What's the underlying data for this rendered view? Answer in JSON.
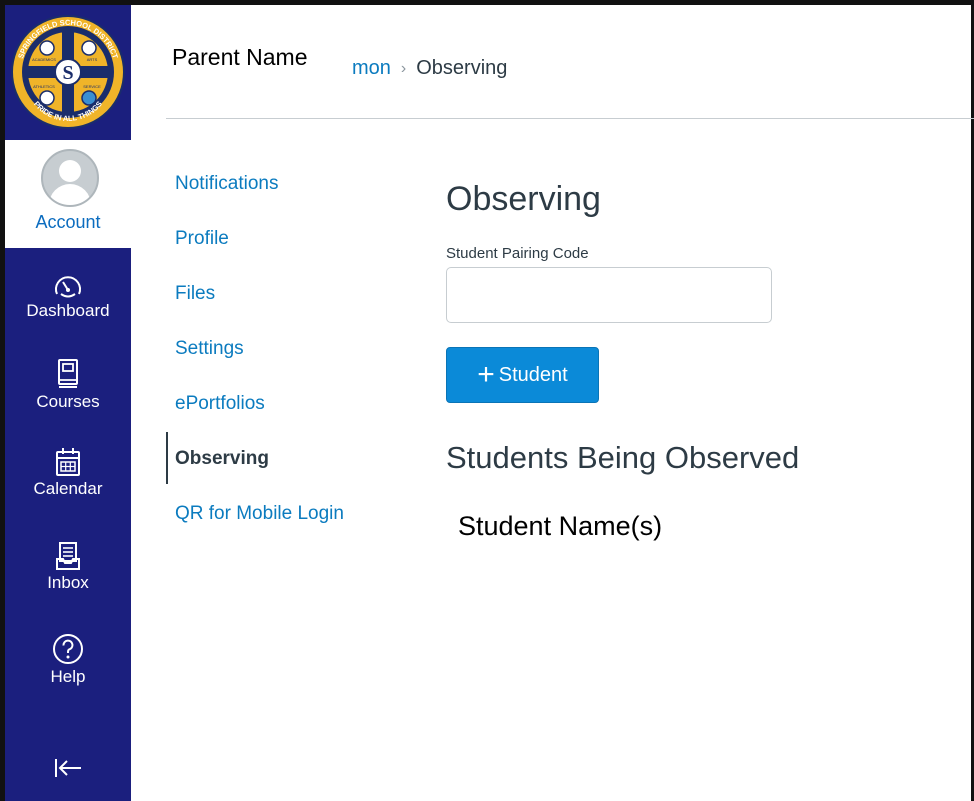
{
  "window": {
    "parent_name": "Parent Name"
  },
  "global_nav": {
    "logo": {
      "alt": "Springfield School District seal",
      "top_text": "SPRINGFIELD SCHOOL DISTRICT",
      "bottom_text": "PRIDE IN ALL THINGS",
      "quadrants": [
        "ACADEMICS",
        "ARTS",
        "ATHLETICS",
        "SERVICE"
      ],
      "center_letter": "S"
    },
    "account": {
      "label": "Account",
      "icon": "user-avatar-icon"
    },
    "items": [
      {
        "label": "Dashboard",
        "icon": "dashboard-gauge-icon"
      },
      {
        "label": "Courses",
        "icon": "courses-book-icon"
      },
      {
        "label": "Calendar",
        "icon": "calendar-icon"
      },
      {
        "label": "Inbox",
        "icon": "inbox-icon"
      },
      {
        "label": "Help",
        "icon": "help-circle-icon"
      }
    ],
    "collapse_icon": "collapse-arrow-icon",
    "colors": {
      "background": "#1b1f7e",
      "active_bg": "#ffffff",
      "active_text": "#0b6cbf"
    }
  },
  "breadcrumb": {
    "link_fragment": "mon",
    "separator": "›",
    "current": "Observing"
  },
  "settings_nav": {
    "items": [
      {
        "label": "Notifications",
        "active": false
      },
      {
        "label": "Profile",
        "active": false
      },
      {
        "label": "Files",
        "active": false
      },
      {
        "label": "Settings",
        "active": false
      },
      {
        "label": "ePortfolios",
        "active": false
      },
      {
        "label": "Observing",
        "active": true
      },
      {
        "label": "QR for Mobile Login",
        "active": false
      }
    ]
  },
  "main": {
    "title": "Observing",
    "pairing_label": "Student Pairing Code",
    "pairing_value": "",
    "add_button": {
      "plus": "+",
      "label": "Student"
    },
    "students_heading": "Students Being Observed",
    "students_text": "Student Name(s)"
  },
  "colors": {
    "link": "#0b7bbf",
    "button": "#0b8ad8",
    "text": "#2d3b45"
  }
}
